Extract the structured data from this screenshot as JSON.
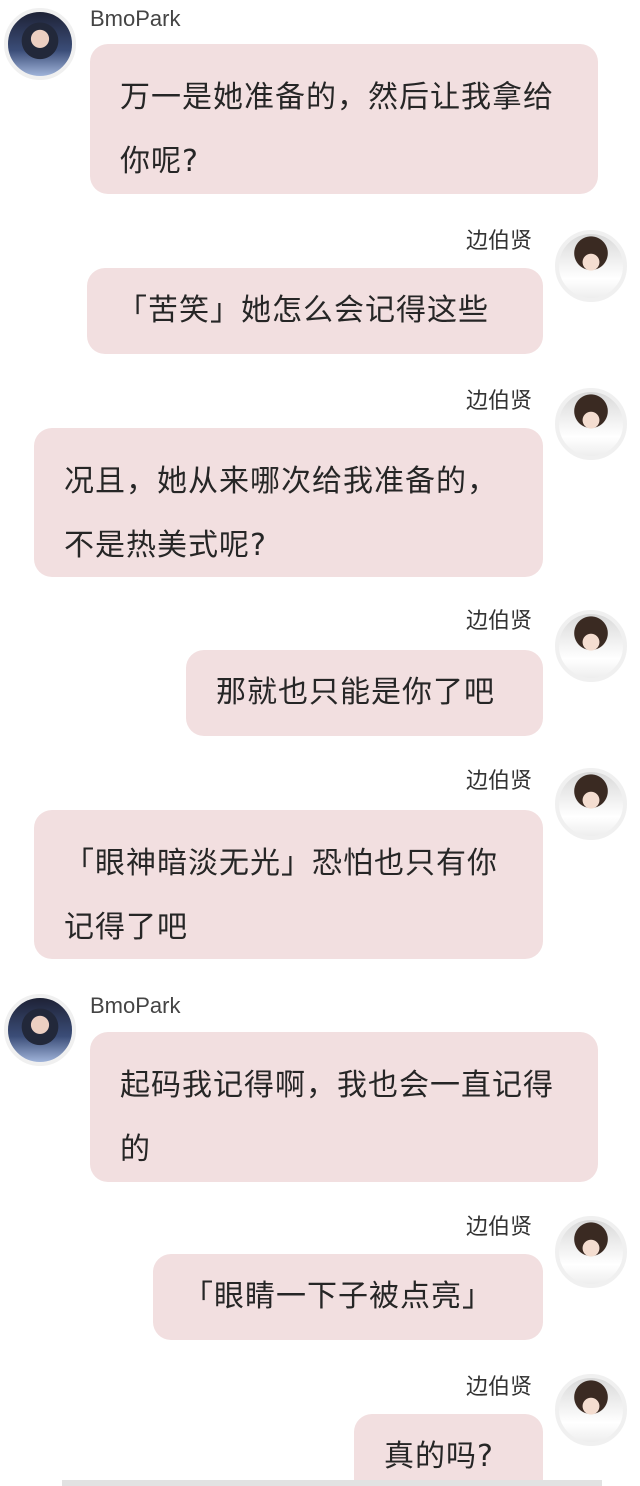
{
  "messages": [
    {
      "sender": "BmoPark",
      "side": "left",
      "text": "万一是她准备的，然后让我拿给你呢?"
    },
    {
      "sender": "边伯贤",
      "side": "right",
      "text": "「苦笑」她怎么会记得这些"
    },
    {
      "sender": "边伯贤",
      "side": "right",
      "text": "况且，她从来哪次给我准备的，不是热美式呢?"
    },
    {
      "sender": "边伯贤",
      "side": "right",
      "text": "那就也只能是你了吧"
    },
    {
      "sender": "边伯贤",
      "side": "right",
      "text": "「眼神暗淡无光」恐怕也只有你记得了吧"
    },
    {
      "sender": "BmoPark",
      "side": "left",
      "text": "起码我记得啊，我也会一直记得的"
    },
    {
      "sender": "边伯贤",
      "side": "right",
      "text": "「眼睛一下子被点亮」"
    },
    {
      "sender": "边伯贤",
      "side": "right",
      "text": "真的吗?"
    }
  ]
}
